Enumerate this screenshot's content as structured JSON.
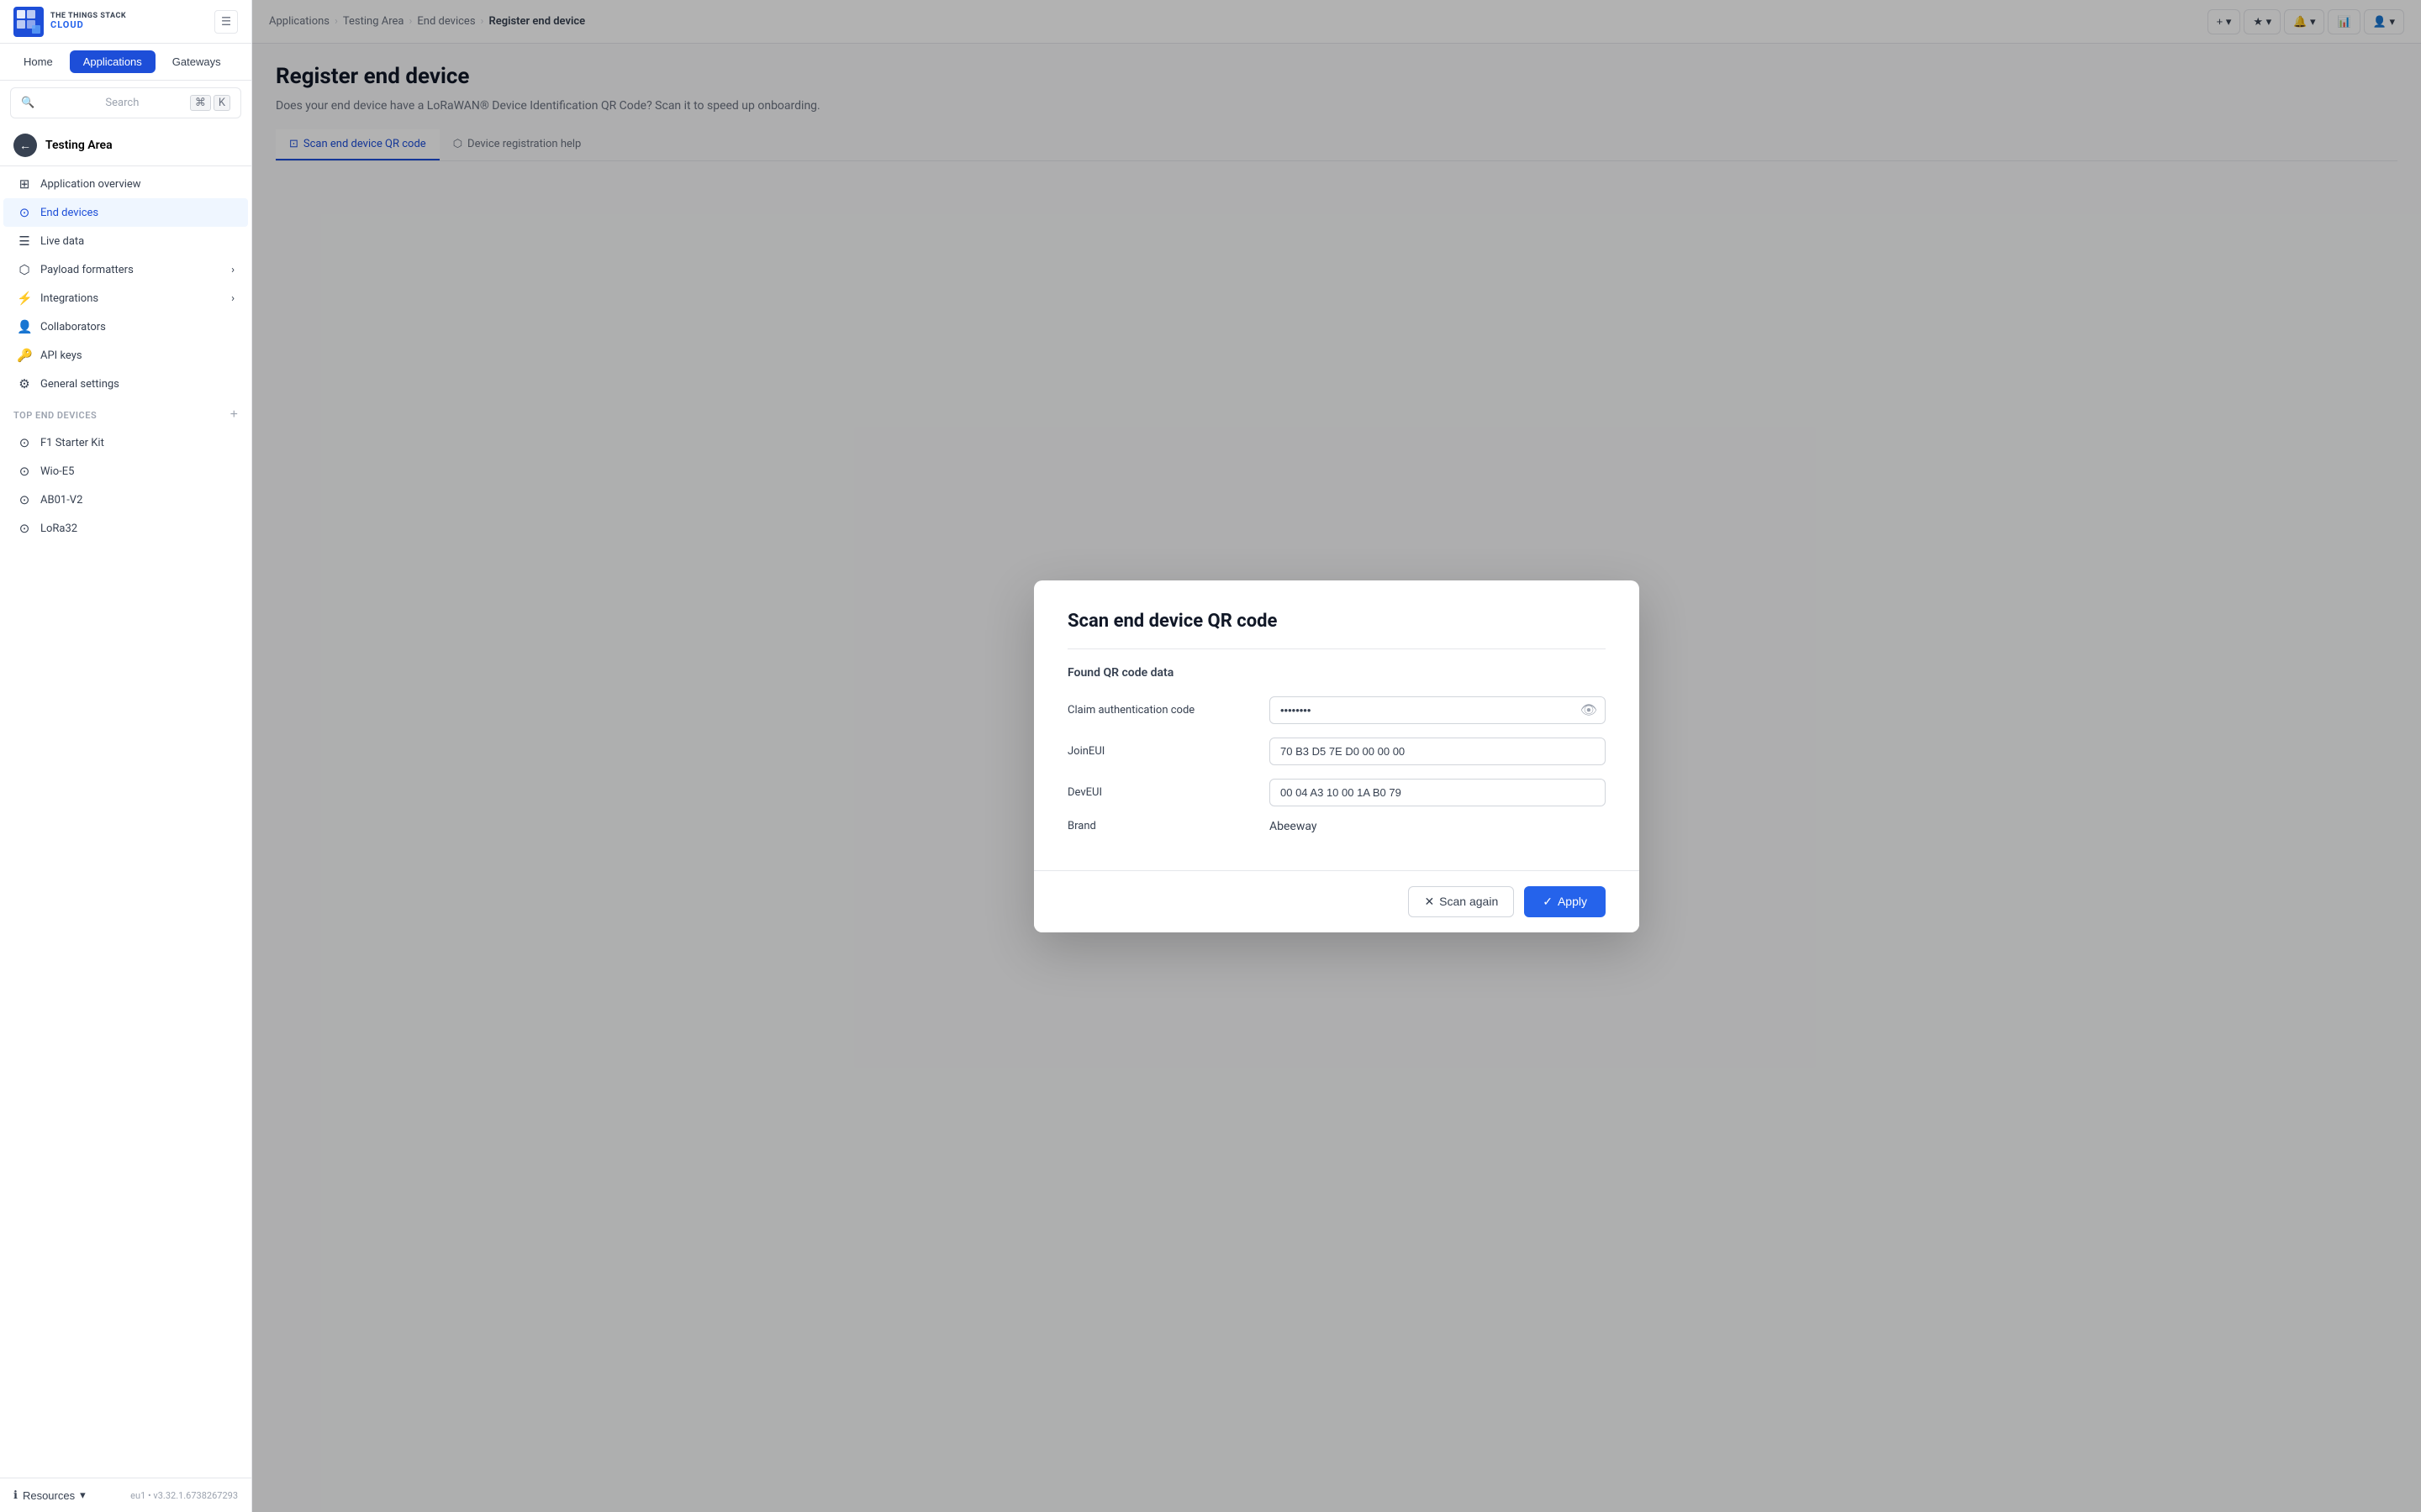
{
  "app": {
    "logo_top": "THE THINGS STACK",
    "logo_bottom": "CLOUD"
  },
  "nav_tabs": [
    {
      "label": "Home",
      "active": false
    },
    {
      "label": "Applications",
      "active": true
    },
    {
      "label": "Gateways",
      "active": false
    }
  ],
  "search": {
    "placeholder": "Search",
    "kbd1": "⌘",
    "kbd2": "K"
  },
  "back_button": {
    "label": "Testing Area"
  },
  "sidebar_items": [
    {
      "icon": "⊞",
      "label": "Application overview"
    },
    {
      "icon": "⊙",
      "label": "End devices",
      "active": true
    },
    {
      "icon": "☰",
      "label": "Live data"
    },
    {
      "icon": "⬡",
      "label": "Payload formatters",
      "expand": true
    },
    {
      "icon": "⚡",
      "label": "Integrations",
      "expand": true
    },
    {
      "icon": "👤",
      "label": "Collaborators"
    },
    {
      "icon": "🔑",
      "label": "API keys"
    },
    {
      "icon": "⚙",
      "label": "General settings"
    }
  ],
  "top_end_devices": {
    "label": "Top end devices",
    "items": [
      {
        "icon": "⊙",
        "label": "F1 Starter Kit"
      },
      {
        "icon": "⊙",
        "label": "Wio-E5"
      },
      {
        "icon": "⊙",
        "label": "AB01-V2"
      },
      {
        "icon": "⊙",
        "label": "LoRa32"
      }
    ]
  },
  "footer": {
    "resources_label": "Resources",
    "version": "eu1 • v3.32.1.6738267293"
  },
  "topbar": {
    "breadcrumb": [
      {
        "label": "Applications",
        "link": true
      },
      {
        "label": "Testing Area",
        "link": true
      },
      {
        "label": "End devices",
        "link": true
      },
      {
        "label": "Register end device",
        "link": false
      }
    ]
  },
  "page": {
    "title": "Register end device",
    "subtitle": "Does your end device have a LoRaWAN® Device Identification QR Code? Scan it to speed up onboarding.",
    "tab_scan": "Scan end device QR code",
    "tab_help": "Device registration help"
  },
  "modal": {
    "title": "Scan end device QR code",
    "found_label": "Found QR code data",
    "fields": {
      "claim_auth_label": "Claim authentication code",
      "claim_auth_value": "••••••••",
      "join_eui_label": "JoinEUI",
      "join_eui_value": "70 B3 D5 7E D0 00 00 00",
      "dev_eui_label": "DevEUI",
      "dev_eui_value": "00 04 A3 10 00 1A B0 79",
      "brand_label": "Brand",
      "brand_value": "Abeeway"
    },
    "btn_scan_again": "Scan again",
    "btn_apply": "Apply"
  }
}
